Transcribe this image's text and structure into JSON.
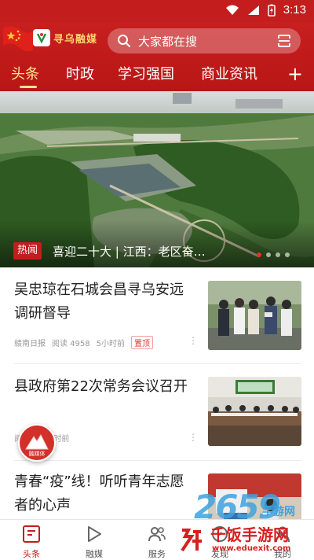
{
  "status_bar": {
    "time": "3:13",
    "bg_color": "#c31d1d"
  },
  "header": {
    "logo_text": "寻乌融媒",
    "search_placeholder": "大家都在搜",
    "tabs": [
      {
        "label": "头条",
        "active": true
      },
      {
        "label": "时政",
        "active": false
      },
      {
        "label": "学习强国",
        "active": false
      },
      {
        "label": "商业资讯",
        "active": false
      }
    ],
    "add_label": "+",
    "accent": "#ffe48a"
  },
  "banner": {
    "tag": "热闻",
    "title": "喜迎二十大 | 江西：老区奋…",
    "slide_count": 4,
    "active_slide": 1
  },
  "news": [
    {
      "title": "吴忠琼在石城会昌寻乌安远调研督导",
      "source": "赣南日报",
      "reads": "阅读 4958",
      "time": "5小时前",
      "tag": "置顶"
    },
    {
      "title": "县政府第22次常务会议召开",
      "source": "阅",
      "reads": "",
      "time": "4小时前",
      "tag": ""
    },
    {
      "title": "青春“疫”线！听听青年志愿者的心声",
      "source": "",
      "reads": "",
      "time": "",
      "tag": ""
    }
  ],
  "float_badge": {
    "label": "融媒体"
  },
  "bottom_nav": [
    {
      "label": "头条",
      "icon": "news-icon",
      "active": true
    },
    {
      "label": "融媒",
      "icon": "play-icon",
      "active": false
    },
    {
      "label": "服务",
      "icon": "people-icon",
      "active": false
    },
    {
      "label": "发现",
      "icon": "discover-icon",
      "active": false
    },
    {
      "label": "我的",
      "icon": "user-icon",
      "active": false
    }
  ],
  "watermark": {
    "text": "千饭手游网",
    "url": "www.eduexit.com",
    "number": "2659",
    "sub": "手游网"
  },
  "colors": {
    "primary_red": "#c31d1d",
    "nav_active": "#c31d1d"
  }
}
